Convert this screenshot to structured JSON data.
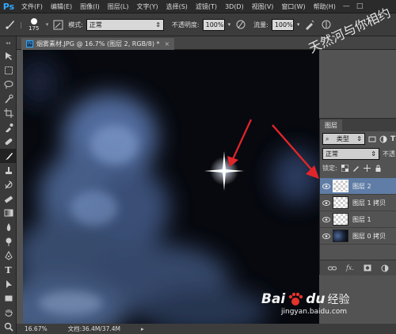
{
  "app": {
    "logo": "Ps"
  },
  "menubar": {
    "items": [
      "文件(F)",
      "编辑(E)",
      "图像(I)",
      "图层(L)",
      "文字(Y)",
      "选择(S)",
      "滤镜(T)",
      "3D(D)",
      "视图(V)",
      "窗口(W)",
      "帮助(H)"
    ],
    "minimize": "—",
    "maximize": "□"
  },
  "options": {
    "brush_size": "175",
    "mode_label": "模式:",
    "mode_value": "正常",
    "opacity_label": "不透明度:",
    "opacity_value": "100%",
    "flow_label": "流量:",
    "flow_value": "100%"
  },
  "document": {
    "tab_title": "烟雾素材.JPG @ 16.7% (图层 2, RGB/8) *"
  },
  "watermark": {
    "text": "天然河与你相约"
  },
  "layers_panel": {
    "tab_label": "图层",
    "filter_value": "类型",
    "blend_value": "正常",
    "opacity_label": "不透",
    "lock_label": "锁定:",
    "layers": [
      {
        "name": "图层 2",
        "selected": true,
        "thumb": "transparent"
      },
      {
        "name": "图层 1 拷贝",
        "selected": false,
        "thumb": "transparent"
      },
      {
        "name": "图层 1",
        "selected": false,
        "thumb": "transparent"
      },
      {
        "name": "图层 0 拷贝",
        "selected": false,
        "thumb": "smoke"
      }
    ]
  },
  "statusbar": {
    "zoom": "16.67%",
    "doc_size": "文档:36.4M/37.4M"
  },
  "baidu": {
    "brand_bai": "Bai",
    "brand_du": "du",
    "jingyan": "经验",
    "url": "jingyan.baidu.com"
  },
  "colors": {
    "accent": "#31a8ff",
    "arrow": "#e0262b",
    "selected_layer": "#5f7da6"
  }
}
